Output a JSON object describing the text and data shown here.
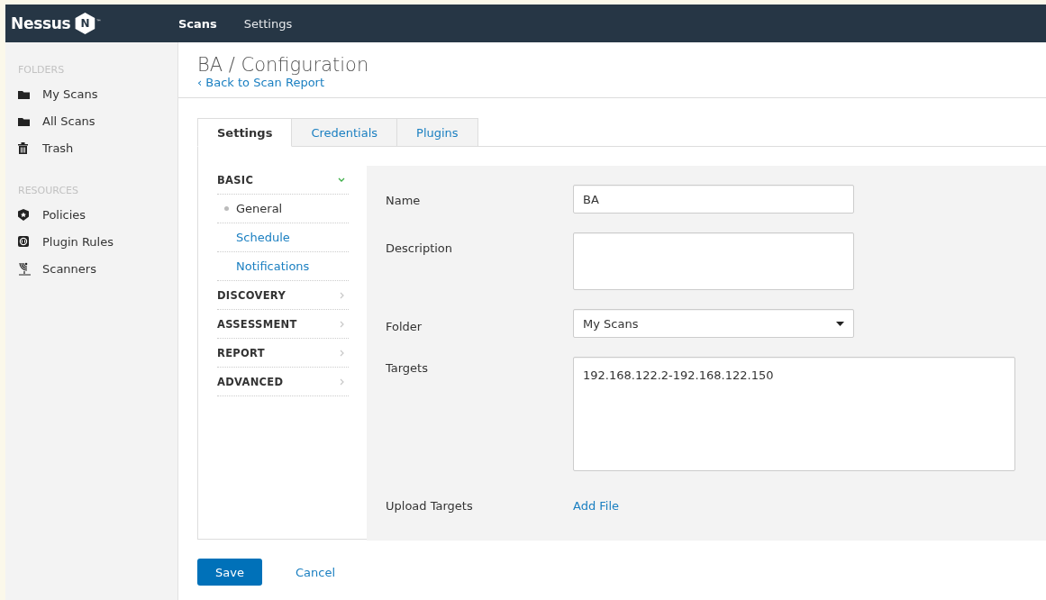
{
  "header": {
    "logo": "Nessus",
    "logo_badge": "N",
    "trademark": "™",
    "nav": [
      {
        "label": "Scans",
        "selected": true
      },
      {
        "label": "Settings",
        "selected": false
      }
    ]
  },
  "sidebar": {
    "sections": [
      {
        "heading": "FOLDERS",
        "items": [
          {
            "label": "My Scans",
            "kind": "folder"
          },
          {
            "label": "All Scans",
            "kind": "folder"
          },
          {
            "label": "Trash",
            "kind": "trash"
          }
        ]
      },
      {
        "heading": "RESOURCES",
        "items": [
          {
            "label": "Policies",
            "kind": "policy"
          },
          {
            "label": "Plugin Rules",
            "kind": "plugin"
          },
          {
            "label": "Scanners",
            "kind": "scanner"
          }
        ]
      }
    ]
  },
  "page": {
    "title": "BA / Configuration",
    "back_link": "‹ Back to Scan Report"
  },
  "tabs": [
    {
      "label": "Settings",
      "selected": true
    },
    {
      "label": "Credentials",
      "selected": false
    },
    {
      "label": "Plugins",
      "selected": false
    }
  ],
  "settings_nav": [
    {
      "label": "BASIC",
      "expanded": true,
      "children": [
        {
          "label": "General",
          "selected": true
        },
        {
          "label": "Schedule",
          "selected": false
        },
        {
          "label": "Notifications",
          "selected": false
        }
      ]
    },
    {
      "label": "DISCOVERY",
      "expanded": false
    },
    {
      "label": "ASSESSMENT",
      "expanded": false
    },
    {
      "label": "REPORT",
      "expanded": false
    },
    {
      "label": "ADVANCED",
      "expanded": false
    }
  ],
  "form": [
    {
      "kind": "text",
      "label": "Name",
      "value": "BA"
    },
    {
      "kind": "textarea",
      "label": "Description"
    },
    {
      "kind": "select",
      "label": "Folder",
      "value": "My Scans"
    },
    {
      "kind": "wide-textarea",
      "label": "Targets",
      "value": "192.168.122.2-192.168.122.150"
    },
    {
      "kind": "link",
      "label": "Upload Targets",
      "link": "Add File"
    }
  ],
  "buttons": [
    {
      "label": "Save",
      "kind": "primary"
    },
    {
      "label": "Cancel",
      "kind": "link"
    }
  ]
}
